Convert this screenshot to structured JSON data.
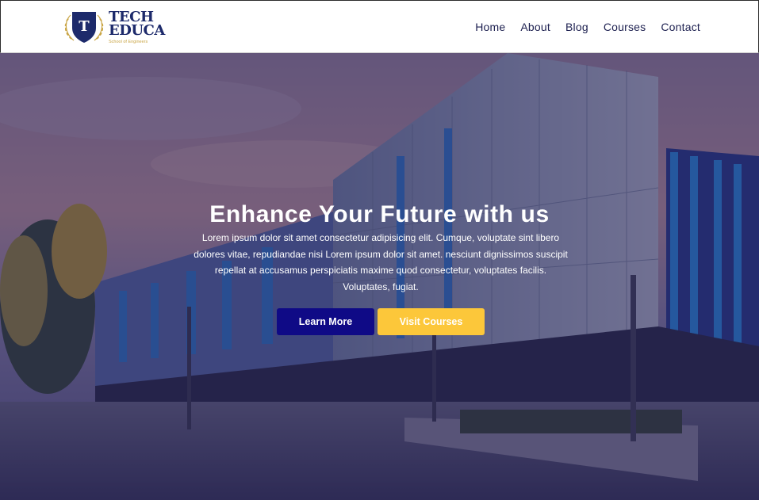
{
  "brand": {
    "line1": "TECH",
    "line2": "EDUCA",
    "tagline": "School of Engineers",
    "emblem_letter": "T",
    "colors": {
      "navy": "#1d2a6b",
      "gold": "#c9a545"
    }
  },
  "nav": {
    "items": [
      {
        "label": "Home"
      },
      {
        "label": "About"
      },
      {
        "label": "Blog"
      },
      {
        "label": "Courses"
      },
      {
        "label": "Contact"
      }
    ]
  },
  "hero": {
    "title": "Enhance Your Future with us",
    "description": "Lorem ipsum dolor sit amet consectetur adipisicing elit. Cumque, voluptate sint libero dolores vitae, repudiandae nisi Lorem ipsum dolor sit amet. nesciunt dignissimos suscipit repellat at accusamus perspiciatis maxime quod consectetur, voluptates facilis. Voluptates, fugiat.",
    "primary_button": "Learn More",
    "secondary_button": "Visit Courses",
    "background_image": "modern-glass-campus-building-photo",
    "colors": {
      "primary_button": "#0f0a86",
      "secondary_button": "#fcc73a",
      "overlay": "#1a164e"
    }
  }
}
